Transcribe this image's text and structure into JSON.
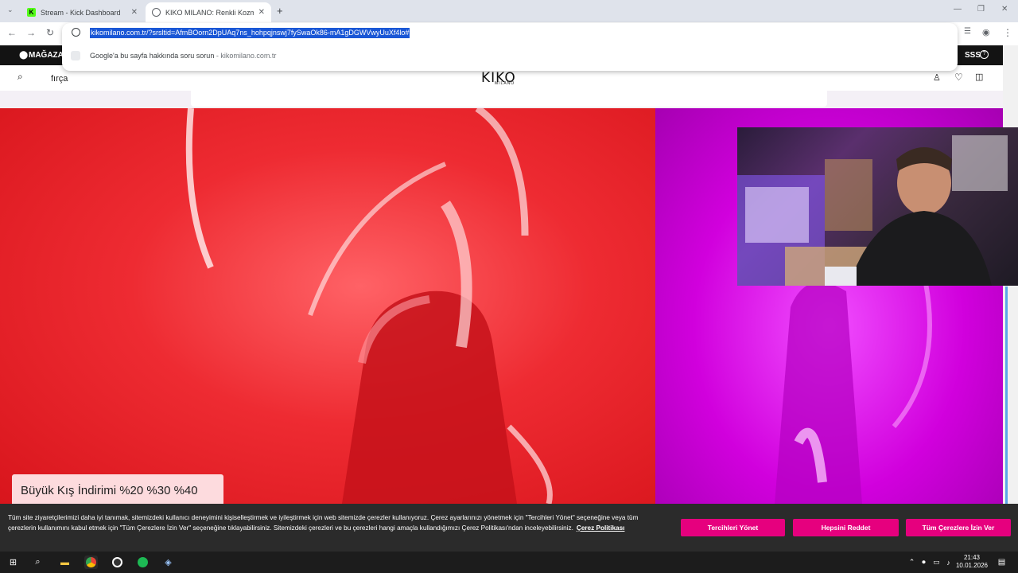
{
  "browser": {
    "tabs": [
      {
        "label": "Stream - Kick Dashboard",
        "favicon": "kick-icon",
        "active": false
      },
      {
        "label": "KIKO MILANO: Renkli Kozmetik",
        "favicon": "globe-icon",
        "active": true
      }
    ],
    "new_tab": "+",
    "url": "kikomilano.com.tr/?srsltid=AfmBOorn2DpUAq7ns_hohpqjnswj7fySwaOk86-mA1gDGWVwyUuXf4lo#",
    "suggestion": {
      "text": "Google'a bu sayfa hakkında soru sorun",
      "separator": " - ",
      "domain": "kikomilano.com.tr"
    }
  },
  "site": {
    "topbar_left": "MAĞAZA",
    "topbar_right": "SSS",
    "search_value": "fırça",
    "logo": "KIKO",
    "logo_sub": "MILANO",
    "promo": "Büyük Kış İndirimi %20 %30 %40"
  },
  "cookie": {
    "text": "Tüm site ziyaretçilerimizi daha iyi tanımak, sitemizdeki kullanıcı deneyimini kişiselleştirmek ve iyileştirmek için web sitemizde çerezler kullanıyoruz. Çerez ayarlarınızı yönetmek için \"Tercihleri Yönet\" seçeneğine veya tüm çerezlerin kullanımını kabul etmek için \"Tüm Çerezlere İzin Ver\" seçeneğine tıklayabilirsiniz. Sitemizdeki çerezleri ve bu çerezleri hangi amaçla kullandığımızı Çerez Politikası'ndan inceleyebilirsiniz.",
    "policy_link": "Çerez Politikası",
    "buttons": {
      "manage": "Tercihleri Yönet",
      "reject": "Hepsini Reddet",
      "accept": "Tüm Çerezlere İzin Ver"
    },
    "accent": "#e6007e"
  },
  "taskbar": {
    "time": "21:43",
    "date": "10.01.2026"
  }
}
